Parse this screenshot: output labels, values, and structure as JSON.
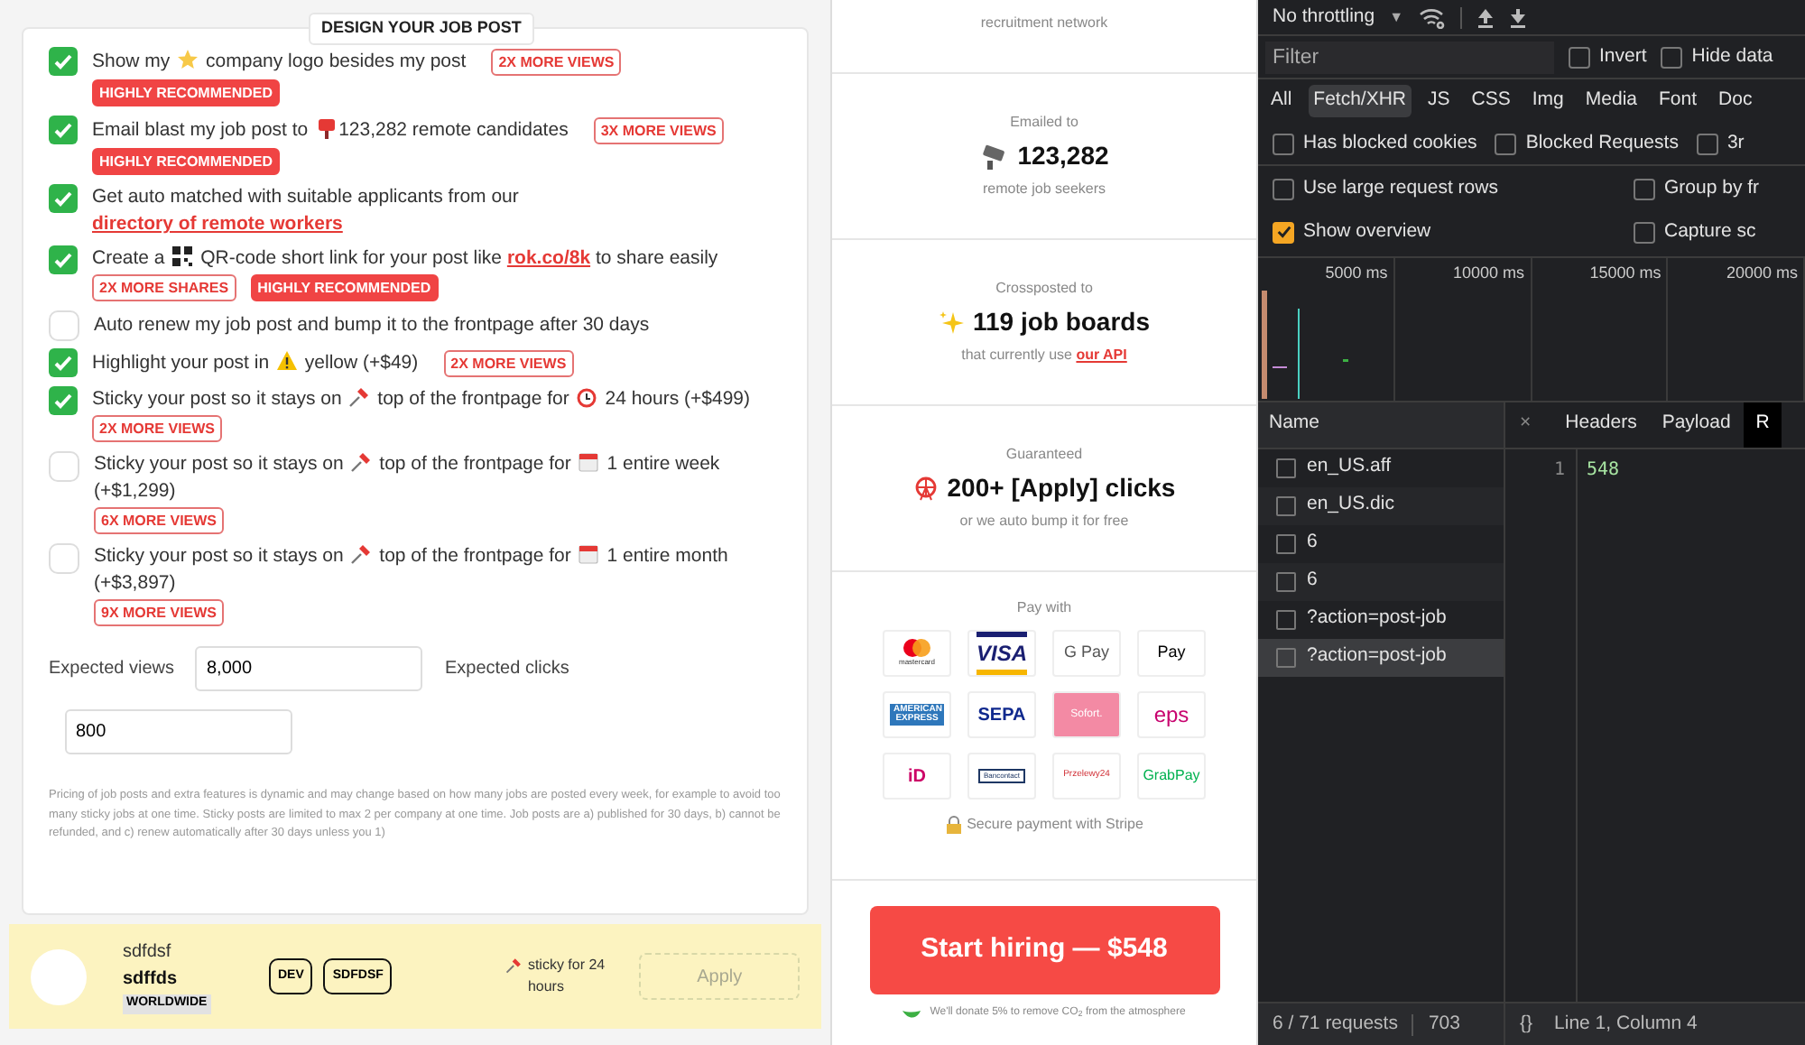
{
  "form": {
    "title": "DESIGN YOUR JOB POST",
    "options": [
      {
        "checked": true,
        "parts": [
          {
            "kind": "text",
            "text": "Show my "
          },
          {
            "kind": "star"
          },
          {
            "kind": "text",
            "text": " company logo besides my post"
          }
        ],
        "badges": [
          {
            "kind": "outline",
            "text": "2X MORE VIEWS"
          },
          {
            "kind": "filled",
            "text": "HIGHLY RECOMMENDED"
          }
        ]
      },
      {
        "checked": true,
        "parts": [
          {
            "kind": "text",
            "text": "Email blast my job post to "
          },
          {
            "kind": "mailbox"
          },
          {
            "kind": "text",
            "text": "123,282 remote candidates"
          }
        ],
        "badges": [
          {
            "kind": "outline",
            "text": "3X MORE VIEWS"
          },
          {
            "kind": "filled",
            "text": "HIGHLY RECOMMENDED"
          }
        ]
      },
      {
        "checked": true,
        "parts": [
          {
            "kind": "text",
            "text": "Get auto matched with suitable applicants from our "
          },
          {
            "kind": "link",
            "text": "directory of remote workers"
          }
        ]
      },
      {
        "checked": true,
        "parts": [
          {
            "kind": "text",
            "text": "Create a "
          },
          {
            "kind": "qr"
          },
          {
            "kind": "text",
            "text": " QR-code short link for your post like "
          },
          {
            "kind": "link",
            "text": "rok.co/8k"
          },
          {
            "kind": "text",
            "text": " to share easily"
          }
        ],
        "badges": [
          {
            "kind": "outline",
            "text": "2X MORE SHARES"
          },
          {
            "kind": "filled",
            "text": "HIGHLY RECOMMENDED"
          }
        ]
      },
      {
        "checked": false,
        "parts": [
          {
            "kind": "text",
            "text": "Auto renew my job post and bump it to the frontpage after 30 days"
          }
        ]
      },
      {
        "checked": true,
        "parts": [
          {
            "kind": "text",
            "text": "Highlight your post in "
          },
          {
            "kind": "warning"
          },
          {
            "kind": "text",
            "text": " yellow (+$49)"
          }
        ],
        "badges": [
          {
            "kind": "outline",
            "text": "2X MORE VIEWS"
          }
        ]
      },
      {
        "checked": true,
        "parts": [
          {
            "kind": "text",
            "text": "Sticky your post so it stays on "
          },
          {
            "kind": "pin"
          },
          {
            "kind": "text",
            "text": " top of the frontpage for "
          },
          {
            "kind": "alarm"
          },
          {
            "kind": "text",
            "text": " 24 hours (+$499)"
          }
        ],
        "badges": [
          {
            "kind": "outline",
            "text": "2X MORE VIEWS"
          }
        ]
      },
      {
        "checked": false,
        "parts": [
          {
            "kind": "text",
            "text": "Sticky your post so it stays on "
          },
          {
            "kind": "pin"
          },
          {
            "kind": "text",
            "text": " top of the frontpage for "
          },
          {
            "kind": "calendar"
          },
          {
            "kind": "text",
            "text": " 1 entire week (+$1,299)"
          }
        ],
        "badges": [
          {
            "kind": "outline",
            "text": "6X MORE VIEWS"
          }
        ]
      },
      {
        "checked": false,
        "parts": [
          {
            "kind": "text",
            "text": "Sticky your post so it stays on "
          },
          {
            "kind": "pin"
          },
          {
            "kind": "text",
            "text": " top of the frontpage for "
          },
          {
            "kind": "calendar"
          },
          {
            "kind": "text",
            "text": " 1 entire month (+$3,897)"
          }
        ],
        "badges": [
          {
            "kind": "outline",
            "text": "9X MORE VIEWS"
          }
        ]
      }
    ],
    "expected_views": {
      "label": "Expected views",
      "value": "8,000"
    },
    "expected_clicks": {
      "label": "Expected clicks",
      "value": "800"
    },
    "note": "Pricing of job posts and extra features is dynamic and may change based on how many jobs are posted every week, for example to avoid too many sticky jobs at one time. Sticky posts are limited to max 2 per company at one time. Job posts are a) published for 30 days, b) cannot be refunded, and c) renew automatically after 30 days unless you 1)"
  },
  "preview": {
    "company": "sdfdsf",
    "position": "sdffds",
    "location": "WORLDWIDE",
    "tags": [
      "DEV",
      "SDFDSF"
    ],
    "sticky": "sticky for 24 hours",
    "apply": "Apply"
  },
  "summary": {
    "top_caption": "recruitment network",
    "stats": [
      {
        "kind": "mail",
        "label": "Emailed to",
        "value": "123,282",
        "caption": "remote job seekers"
      },
      {
        "kind": "sparkles",
        "label": "Crossposted to",
        "value": "119 job boards",
        "caption": "that currently use ",
        "link": "our API"
      },
      {
        "kind": "wheel",
        "label": "Guaranteed",
        "value": "200+ [Apply] clicks",
        "caption": "or we auto bump it for free"
      }
    ],
    "pay_label": "Pay with",
    "payment_methods": [
      {
        "kind": "mastercard",
        "label": "mastercard"
      },
      {
        "kind": "visa",
        "label": "VISA"
      },
      {
        "kind": "gpay",
        "label": "G Pay"
      },
      {
        "kind": "applepay",
        "label": "Pay"
      },
      {
        "kind": "amex",
        "label": "AMERICAN EXPRESS"
      },
      {
        "kind": "sepa",
        "label": "SEPA"
      },
      {
        "kind": "sofort",
        "label": "Sofort."
      },
      {
        "kind": "eps",
        "label": "eps"
      },
      {
        "kind": "ideal",
        "label": "iD"
      },
      {
        "kind": "bancontact",
        "label": "Bancontact"
      },
      {
        "kind": "p24",
        "label": "Przelewy24"
      },
      {
        "kind": "grabpay",
        "label": "GrabPay"
      }
    ],
    "secure": "Secure payment with Stripe",
    "cta": "Start hiring — $548",
    "donate": "We'll donate 5% to remove CO$_{2}$ from the atmosphere"
  },
  "devtools": {
    "throttling": "No throttling",
    "dropdown": "▼",
    "filter_placeholder": "Filter",
    "filter_checks": [
      {
        "label": "Invert",
        "checked": false
      },
      {
        "label": "Hide data",
        "checked": false
      }
    ],
    "types": [
      {
        "label": "All",
        "selected": false
      },
      {
        "label": "Fetch/XHR",
        "selected": true
      },
      {
        "label": "JS",
        "selected": false
      },
      {
        "label": "CSS",
        "selected": false
      },
      {
        "label": "Img",
        "selected": false
      },
      {
        "label": "Media",
        "selected": false
      },
      {
        "label": "Font",
        "selected": false
      },
      {
        "label": "Doc",
        "selected": false
      }
    ],
    "blocked_checks": [
      {
        "label": "Has blocked cookies",
        "checked": false
      },
      {
        "label": "Blocked Requests",
        "checked": false
      },
      {
        "label": "3r",
        "checked": false
      }
    ],
    "settings": [
      {
        "label": "Use large request rows",
        "checked": false
      },
      {
        "label": "Group by fr",
        "checked": false
      },
      {
        "label": "Show overview",
        "checked": true
      },
      {
        "label": "Capture sc",
        "checked": false
      }
    ],
    "timeline_ticks": [
      "5000 ms",
      "10000 ms",
      "15000 ms",
      "20000 ms"
    ],
    "name_header": "Name",
    "requests": [
      {
        "name": "en_US.aff",
        "selected": false
      },
      {
        "name": "en_US.dic",
        "selected": false
      },
      {
        "name": "6",
        "selected": false
      },
      {
        "name": "6",
        "selected": false
      },
      {
        "name": "?action=post-job",
        "selected": false
      },
      {
        "name": "?action=post-job",
        "selected": true
      }
    ],
    "close": "×",
    "tabs": [
      {
        "label": "Headers",
        "selected": false
      },
      {
        "label": "Payload",
        "selected": false
      },
      {
        "label": "R",
        "selected": true
      }
    ],
    "code": [
      {
        "line": "1",
        "text": "548"
      }
    ],
    "status": {
      "requests": "6 / 71 requests",
      "transfer": "703",
      "format": "{}",
      "position": "Line 1, Column 4"
    }
  }
}
